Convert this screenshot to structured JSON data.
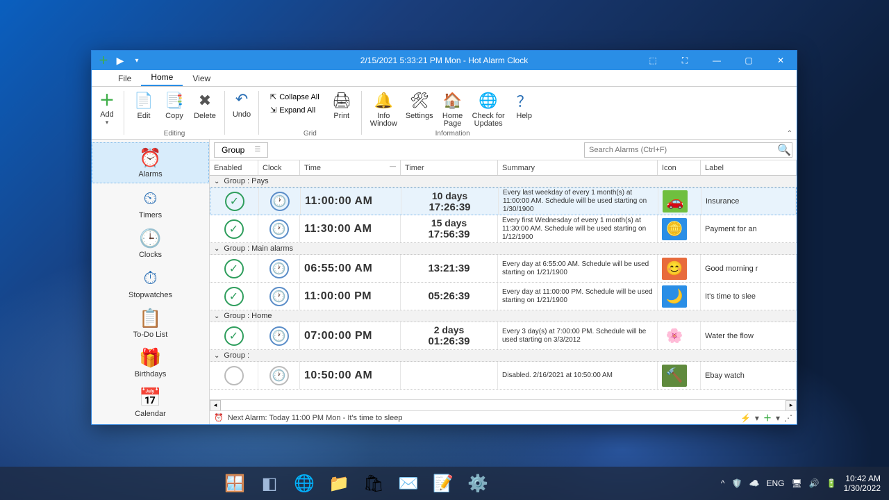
{
  "window": {
    "title": "2/15/2021 5:33:21 PM Mon - Hot Alarm Clock"
  },
  "tabs": {
    "file": "File",
    "home": "Home",
    "view": "View"
  },
  "ribbon": {
    "add": "Add",
    "edit": "Edit",
    "copy": "Copy",
    "delete": "Delete",
    "undo": "Undo",
    "collapse_all": "Collapse All",
    "expand_all": "Expand All",
    "print": "Print",
    "info_window": "Info\nWindow",
    "settings": "Settings",
    "home_page": "Home\nPage",
    "check_updates": "Check for\nUpdates",
    "help": "Help",
    "group_editing": "Editing",
    "group_grid": "Grid",
    "group_information": "Information"
  },
  "sidebar": {
    "alarms": "Alarms",
    "timers": "Timers",
    "clocks": "Clocks",
    "stopwatches": "Stopwatches",
    "todo": "To-Do List",
    "birthdays": "Birthdays",
    "calendar": "Calendar"
  },
  "gridbar": {
    "group_label": "Group",
    "search_placeholder": "Search Alarms (Ctrl+F)"
  },
  "columns": {
    "enabled": "Enabled",
    "clock": "Clock",
    "time": "Time",
    "timer": "Timer",
    "summary": "Summary",
    "icon": "Icon",
    "label": "Label"
  },
  "groups": [
    {
      "name": "Group : Pays",
      "rows": [
        {
          "enabled": true,
          "time": "11:00:00 AM",
          "timer_top": "10 days",
          "timer_bottom": "17:26:39",
          "summary": "Every last weekday of every 1 month(s) at 11:00:00 AM. Schedule will be used starting on 1/30/1900",
          "icon_bg": "#6fbf3f",
          "icon_glyph": "🚗",
          "label": "Insurance",
          "selected": true
        },
        {
          "enabled": true,
          "time": "11:30:00 AM",
          "timer_top": "15 days",
          "timer_bottom": "17:56:39",
          "summary": "Every first Wednesday of every 1 month(s) at 11:30:00 AM. Schedule will be used starting on 1/12/1900",
          "icon_bg": "#2a8ee6",
          "icon_glyph": "🪙",
          "label": "Payment for an"
        }
      ]
    },
    {
      "name": "Group : Main alarms",
      "rows": [
        {
          "enabled": true,
          "time": "06:55:00 AM",
          "timer_top": "",
          "timer_bottom": "13:21:39",
          "summary": "Every day at 6:55:00 AM. Schedule will be used starting on 1/21/1900",
          "icon_bg": "#e86b3c",
          "icon_glyph": "😊",
          "label": "Good morning r"
        },
        {
          "enabled": true,
          "time": "11:00:00 PM",
          "timer_top": "",
          "timer_bottom": "05:26:39",
          "summary": "Every day at 11:00:00 PM. Schedule will be used starting on 1/21/1900",
          "icon_bg": "#2a8ee6",
          "icon_glyph": "🌙",
          "label": "It's time to slee"
        }
      ]
    },
    {
      "name": "Group : Home",
      "rows": [
        {
          "enabled": true,
          "time": "07:00:00 PM",
          "timer_top": "2 days",
          "timer_bottom": "01:26:39",
          "summary": "Every 3 day(s) at 7:00:00 PM. Schedule will be used starting on 3/3/2012",
          "icon_bg": "#ffffff",
          "icon_glyph": "🌸",
          "label": "Water the flow"
        }
      ]
    },
    {
      "name": "Group :",
      "rows": [
        {
          "enabled": false,
          "time": "10:50:00 AM",
          "timer_top": "",
          "timer_bottom": "",
          "summary": "Disabled. 2/16/2021 at 10:50:00 AM",
          "icon_bg": "#5f8a3d",
          "icon_glyph": "🔨",
          "label": "Ebay watch"
        }
      ]
    }
  ],
  "status": {
    "next_alarm": "Next Alarm: Today 11:00 PM Mon - It's time to sleep"
  },
  "taskbar": {
    "lang": "ENG",
    "time": "10:42 AM",
    "date": "1/30/2022"
  }
}
